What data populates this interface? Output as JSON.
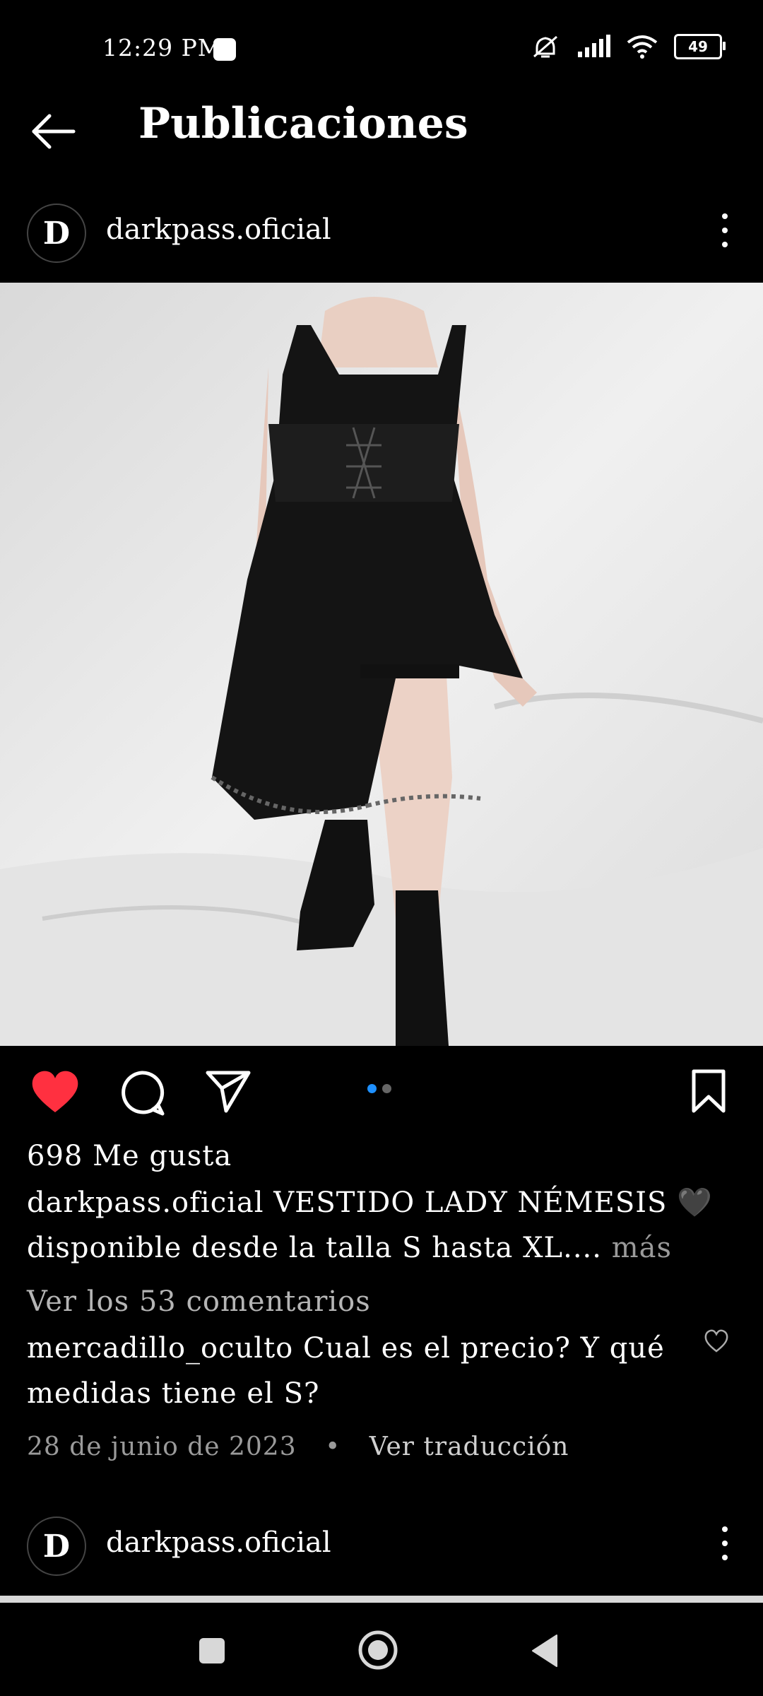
{
  "status_bar": {
    "time": "12:29 PM",
    "battery": "49"
  },
  "header": {
    "title": "Publicaciones"
  },
  "post": {
    "avatar_letter": "D",
    "username": "darkpass.oficial",
    "likes": "698 Me gusta",
    "caption_user": "darkpass.oficial",
    "caption_line1": "VESTIDO LADY NÉMESIS 🖤",
    "caption_line2": "disponible desde la talla S hasta XL....",
    "more_label": "más",
    "view_comments": "Ver los 53 comentarios",
    "comment_user": "mercadillo_oculto",
    "comment_line1": "Cual es el precio? Y qué",
    "comment_line2": "medidas tiene el S?",
    "date": "28 de junio de 2023",
    "separator": "•",
    "translate": "Ver traducción",
    "carousel_index": 1,
    "carousel_total": 2
  },
  "next_post": {
    "avatar_letter": "D",
    "username": "darkpass.oficial"
  },
  "colors": {
    "like": "#ff3040",
    "carousel_active": "#1e90ff"
  }
}
